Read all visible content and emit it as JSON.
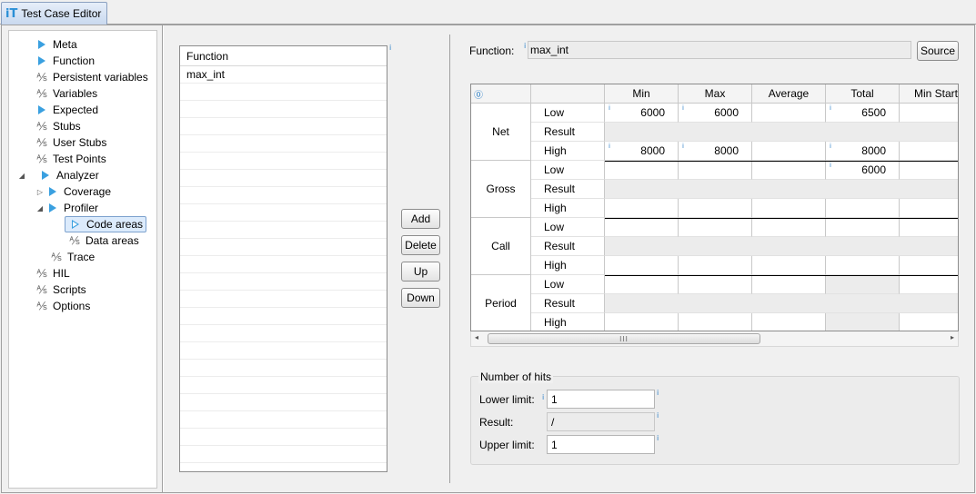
{
  "tab": {
    "icon": "iT",
    "title": "Test Case Editor"
  },
  "tree": {
    "items": [
      {
        "label": "Meta",
        "icon": "play-filled"
      },
      {
        "label": "Function",
        "icon": "play-filled"
      },
      {
        "label": "Persistent variables",
        "icon": "sigma"
      },
      {
        "label": "Variables",
        "icon": "sigma"
      },
      {
        "label": "Expected",
        "icon": "play-filled"
      },
      {
        "label": "Stubs",
        "icon": "sigma"
      },
      {
        "label": "User Stubs",
        "icon": "sigma"
      },
      {
        "label": "Test Points",
        "icon": "sigma"
      },
      {
        "label": "Analyzer",
        "icon": "play-filled"
      },
      {
        "label": "Coverage",
        "icon": "play-filled"
      },
      {
        "label": "Profiler",
        "icon": "play-filled"
      },
      {
        "label": "Code areas",
        "icon": "play-outline"
      },
      {
        "label": "Data areas",
        "icon": "sigma"
      },
      {
        "label": "Trace",
        "icon": "sigma"
      },
      {
        "label": "HIL",
        "icon": "sigma"
      },
      {
        "label": "Scripts",
        "icon": "sigma"
      },
      {
        "label": "Options",
        "icon": "sigma"
      }
    ]
  },
  "function_list": {
    "header": "Function",
    "rows": [
      "max_int"
    ]
  },
  "buttons": {
    "add": "Add",
    "delete": "Delete",
    "up": "Up",
    "down": "Down",
    "source": "Source"
  },
  "function_field": {
    "label": "Function:",
    "value": "max_int"
  },
  "grid": {
    "columns": [
      "Min",
      "Max",
      "Average",
      "Total",
      "Min Start"
    ],
    "groups": [
      {
        "name": "Net",
        "rows": [
          {
            "label": "Low",
            "values": [
              "6000",
              "6000",
              "",
              "6500",
              ""
            ]
          },
          {
            "label": "Result",
            "values": [
              "",
              "",
              "",
              "",
              ""
            ]
          },
          {
            "label": "High",
            "values": [
              "8000",
              "8000",
              "",
              "8000",
              ""
            ]
          }
        ]
      },
      {
        "name": "Gross",
        "rows": [
          {
            "label": "Low",
            "values": [
              "",
              "",
              "",
              "6000",
              ""
            ]
          },
          {
            "label": "Result",
            "values": [
              "",
              "",
              "",
              "",
              ""
            ]
          },
          {
            "label": "High",
            "values": [
              "",
              "",
              "",
              "",
              ""
            ]
          }
        ]
      },
      {
        "name": "Call",
        "rows": [
          {
            "label": "Low",
            "values": [
              "",
              "",
              "",
              "",
              ""
            ]
          },
          {
            "label": "Result",
            "values": [
              "",
              "",
              "",
              "",
              ""
            ]
          },
          {
            "label": "High",
            "values": [
              "",
              "",
              "",
              "",
              ""
            ]
          }
        ]
      },
      {
        "name": "Period",
        "rows": [
          {
            "label": "Low",
            "values": [
              "",
              "",
              "",
              "",
              ""
            ]
          },
          {
            "label": "Result",
            "values": [
              "",
              "",
              "",
              "",
              ""
            ]
          },
          {
            "label": "High",
            "values": [
              "",
              "",
              "",
              "",
              ""
            ]
          }
        ]
      }
    ],
    "scroll_grip": "III"
  },
  "hits": {
    "title": "Number of hits",
    "lower_label": "Lower limit:",
    "lower_value": "1",
    "result_label": "Result:",
    "result_value": "/",
    "upper_label": "Upper limit:",
    "upper_value": "1"
  },
  "colors": {
    "accent": "#3aa0e0",
    "info": "#2a7fc8",
    "selection": "#dcebfc"
  }
}
